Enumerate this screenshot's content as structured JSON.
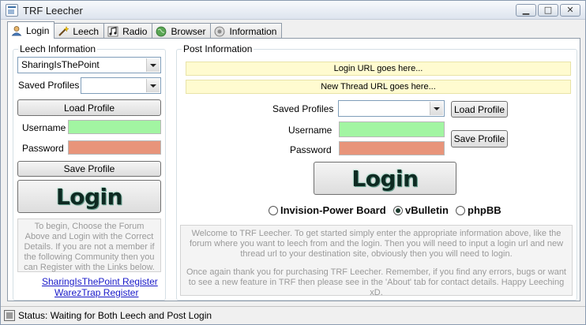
{
  "window": {
    "title": "TRF Leecher",
    "min_glyph": "▁",
    "max_glyph": "□",
    "close_glyph": "✕"
  },
  "tabs": [
    {
      "label": "Login",
      "icon": "user-icon",
      "active": true
    },
    {
      "label": "Leech",
      "icon": "wand-icon",
      "active": false
    },
    {
      "label": "Radio",
      "icon": "music-icon",
      "active": false
    },
    {
      "label": "Browser",
      "icon": "globe-icon",
      "active": false
    },
    {
      "label": "Information",
      "icon": "info-icon",
      "active": false
    }
  ],
  "leech": {
    "legend": "Leech Information",
    "forum_select": "SharingIsThePoint",
    "saved_profiles_label": "Saved Profiles",
    "saved_profiles_value": "",
    "load_profile": "Load Profile",
    "username_label": "Username",
    "password_label": "Password",
    "save_profile": "Save Profile",
    "login": "Login",
    "help_text": "To begin, Choose the Forum Above and Login with the Correct Details. If you are not a member if the following Community then you can Register with the Links below.",
    "links": [
      "SharingIsThePoint Register",
      "WarezTrap Register"
    ]
  },
  "post": {
    "legend": "Post Information",
    "login_url_placeholder": "Login URL goes here...",
    "new_thread_url_placeholder": "New Thread URL goes here...",
    "saved_profiles_label": "Saved Profiles",
    "saved_profiles_value": "",
    "load_profile": "Load Profile",
    "username_label": "Username",
    "password_label": "Password",
    "save_profile": "Save Profile",
    "login": "Login",
    "radios": [
      {
        "label": "Invision-Power Board",
        "checked": false
      },
      {
        "label": "vBulletin",
        "checked": true
      },
      {
        "label": "phpBB",
        "checked": false
      }
    ],
    "welcome_text": "Welcome to TRF Leecher. To get started simply enter the appropriate information above, like the forum where you want to leech from and the login. Then you will need to input a login url and new thread url to your destination site, obviously then you will need to login.",
    "thanks_text": "Once again thank you for purchasing TRF Leecher. Remember, if you find any errors, bugs or want to see a new feature in TRF then please see in the 'About' tab for contact details. Happy Leeching xD."
  },
  "status": {
    "text": "Status: Waiting for Both Leech and Post Login"
  },
  "colors": {
    "username_field": "#a2f5a2",
    "password_field": "#e8947a",
    "url_field": "#fffbd0",
    "link": "#1818c8"
  }
}
